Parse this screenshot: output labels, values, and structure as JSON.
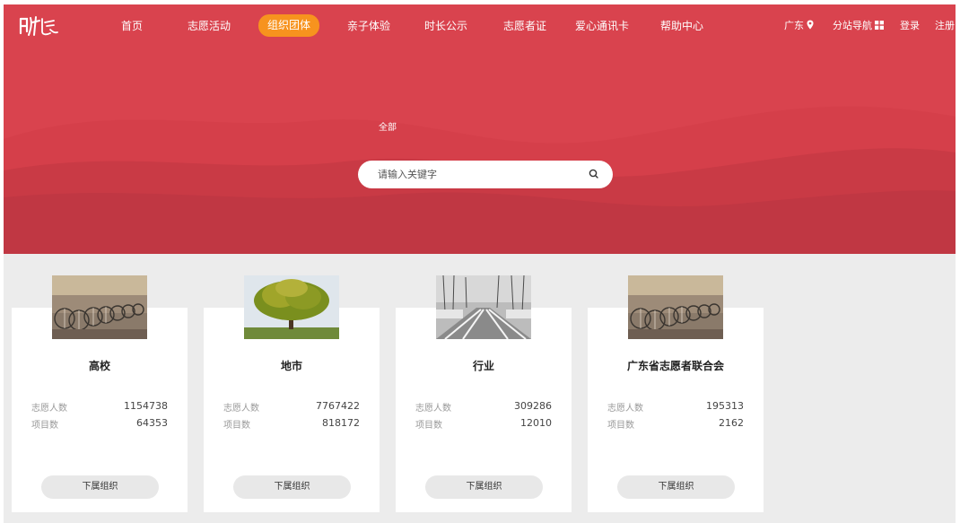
{
  "nav": {
    "items": [
      {
        "label": "首页"
      },
      {
        "label": "志愿活动"
      },
      {
        "label": "组织团体"
      },
      {
        "label": "亲子体验"
      },
      {
        "label": "时长公示"
      },
      {
        "label": "志愿者证"
      },
      {
        "label": "爱心通讯卡"
      },
      {
        "label": "帮助中心"
      }
    ],
    "active_index": 2,
    "region": "广东",
    "subsite_nav": "分站导航",
    "login": "登录",
    "register": "注册",
    "accent_color": "#f7931e",
    "hero_color": "#d9434e"
  },
  "filter": {
    "all_label": "全部"
  },
  "search": {
    "placeholder": "请输入关键字",
    "value": ""
  },
  "cards": [
    {
      "title": "高校",
      "volunteers_label": "志愿人数",
      "volunteers": "1154738",
      "projects_label": "项目数",
      "projects": "64353",
      "button": "下属组织",
      "image": "bicycles-photo"
    },
    {
      "title": "地市",
      "volunteers_label": "志愿人数",
      "volunteers": "7767422",
      "projects_label": "项目数",
      "projects": "818172",
      "button": "下属组织",
      "image": "tree-photo"
    },
    {
      "title": "行业",
      "volunteers_label": "志愿人数",
      "volunteers": "309286",
      "projects_label": "项目数",
      "projects": "12010",
      "button": "下属组织",
      "image": "snowy-road-photo"
    },
    {
      "title": "广东省志愿者联合会",
      "volunteers_label": "志愿人数",
      "volunteers": "195313",
      "projects_label": "项目数",
      "projects": "2162",
      "button": "下属组织",
      "image": "bicycles-photo"
    }
  ]
}
